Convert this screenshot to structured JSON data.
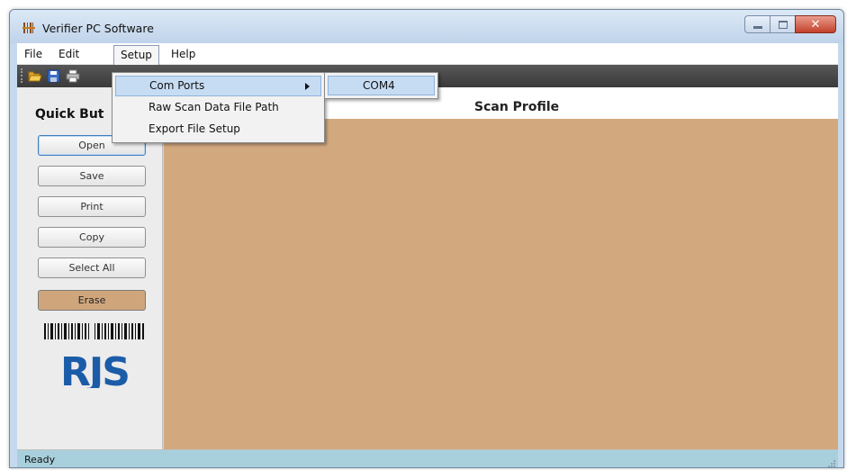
{
  "window": {
    "title": "Verifier PC Software",
    "close_glyph": "✕"
  },
  "menubar": {
    "file": "File",
    "edit": "Edit",
    "setup": "Setup",
    "help": "Help"
  },
  "toolbar": {
    "icons": [
      "open-folder-icon",
      "save-disk-icon",
      "print-icon"
    ]
  },
  "quick_buttons": {
    "heading": "Quick But",
    "open": "Open",
    "save": "Save",
    "print": "Print",
    "copy": "Copy",
    "select_all": "Select All",
    "erase": "Erase"
  },
  "logo": {
    "text": "RJS"
  },
  "main": {
    "title": "Scan Profile"
  },
  "setup_menu": {
    "com_ports": "Com Ports",
    "raw_scan_path": "Raw Scan Data File Path",
    "export_setup": "Export File Setup"
  },
  "com_ports_submenu": {
    "items": [
      "COM4"
    ]
  },
  "status": {
    "text": "Ready"
  },
  "colors": {
    "scan_area": "#d2a97f",
    "erase_button": "#cfa67c",
    "status_bar": "#a8d0dc",
    "menu_highlight": "#c6dcf3"
  }
}
